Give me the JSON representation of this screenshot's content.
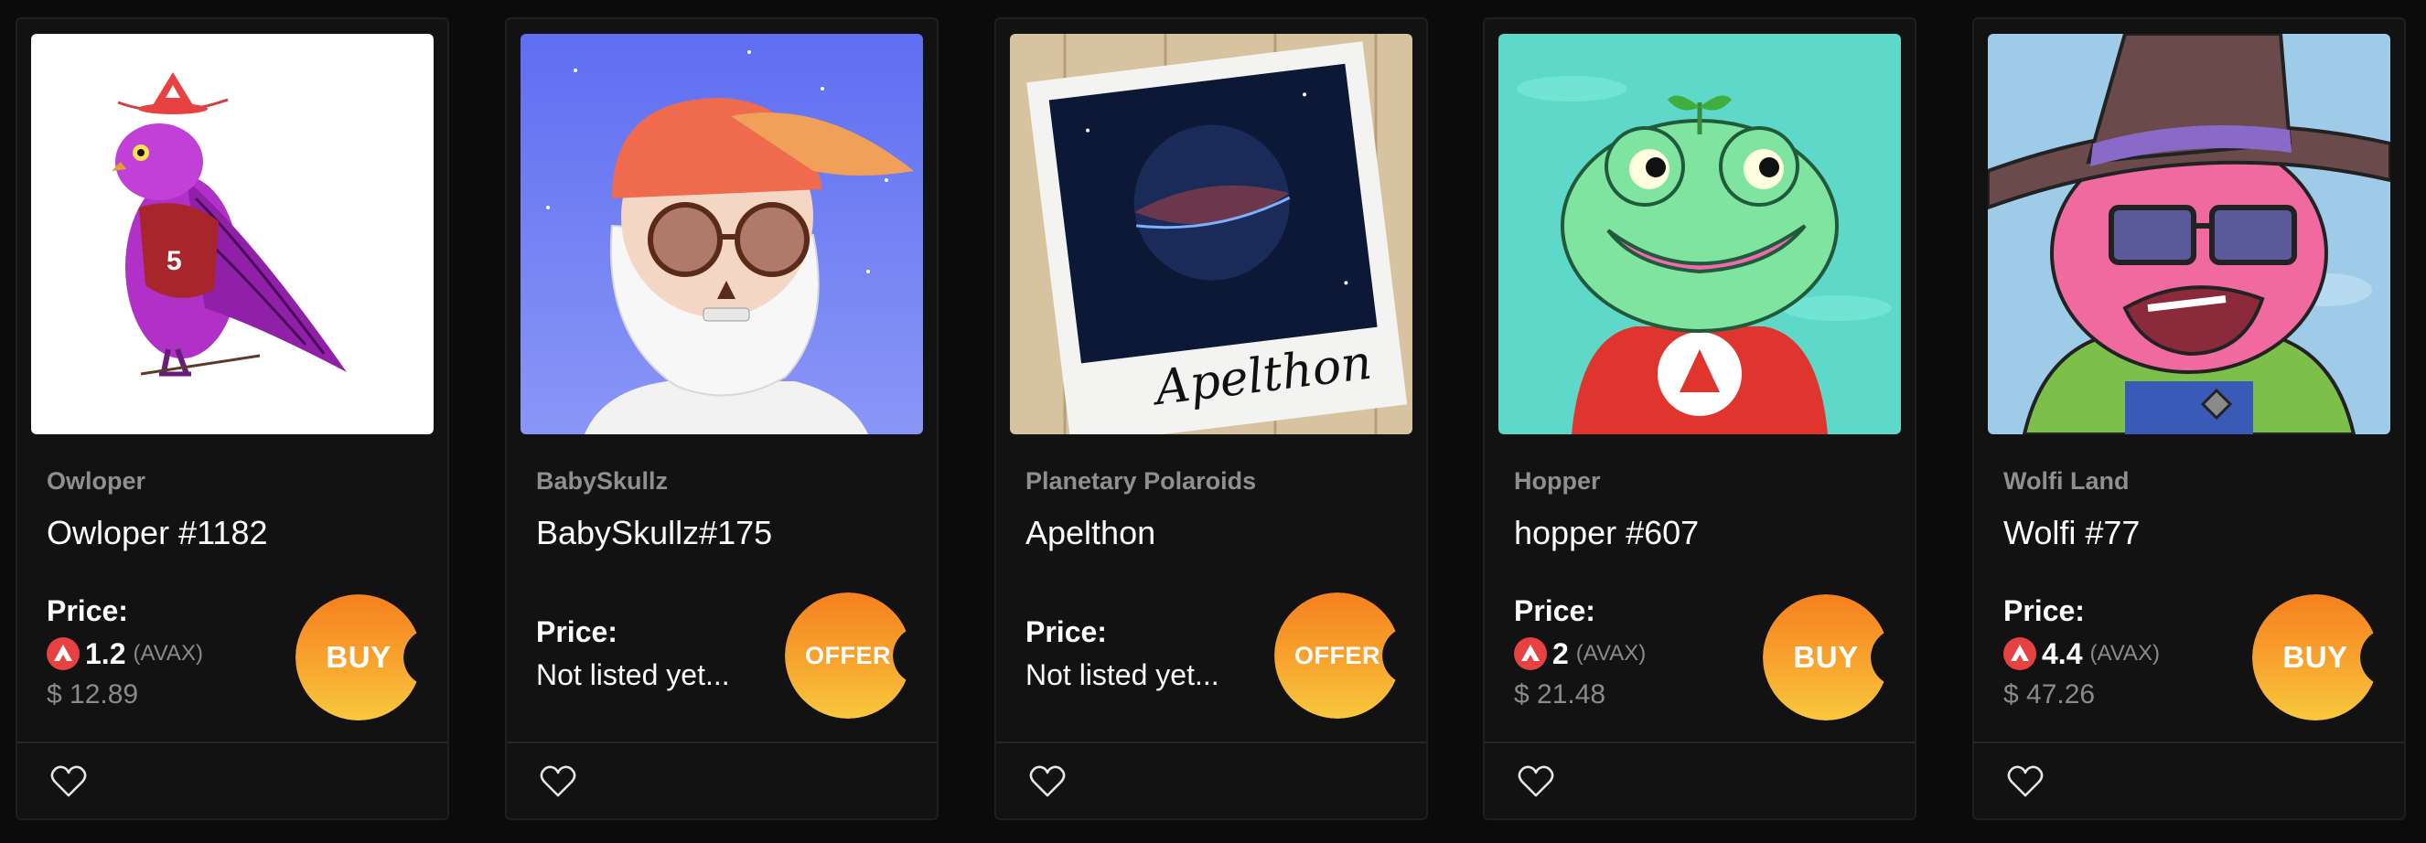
{
  "colors": {
    "background": "#0b0b0b",
    "card": "#121212",
    "button_top": "#f6801f",
    "button_bottom": "#f9c83c",
    "avax_red": "#e84142",
    "muted_text": "#8f8f8f"
  },
  "cards": [
    {
      "collection": "Owloper",
      "title": "Owloper #1182",
      "price_label": "Price:",
      "price_value": "1.2",
      "price_currency": "(AVAX)",
      "price_usd": "$ 12.89",
      "action_label": "BUY",
      "listed": true,
      "image": "purple-owl-art",
      "favorite_icon": "heart-icon"
    },
    {
      "collection": "BabySkullz",
      "title": "BabySkullz#175",
      "price_label": "Price:",
      "price_status": "Not listed yet...",
      "action_label": "OFFER",
      "listed": false,
      "image": "bearded-skull-art",
      "favorite_icon": "heart-icon"
    },
    {
      "collection": "Planetary Polaroids",
      "title": "Apelthon",
      "price_label": "Price:",
      "price_status": "Not listed yet...",
      "action_label": "OFFER",
      "listed": false,
      "image": "planet-polaroid-art",
      "image_caption": "Apelthon",
      "favorite_icon": "heart-icon"
    },
    {
      "collection": "Hopper",
      "title": "hopper #607",
      "price_label": "Price:",
      "price_value": "2",
      "price_currency": "(AVAX)",
      "price_usd": "$ 21.48",
      "action_label": "BUY",
      "listed": true,
      "image": "green-frog-art",
      "favorite_icon": "heart-icon"
    },
    {
      "collection": "Wolfi Land",
      "title": "Wolfi #77",
      "price_label": "Price:",
      "price_value": "4.4",
      "price_currency": "(AVAX)",
      "price_usd": "$ 47.26",
      "action_label": "BUY",
      "listed": true,
      "image": "pink-wolf-wizard-art",
      "favorite_icon": "heart-icon"
    }
  ]
}
